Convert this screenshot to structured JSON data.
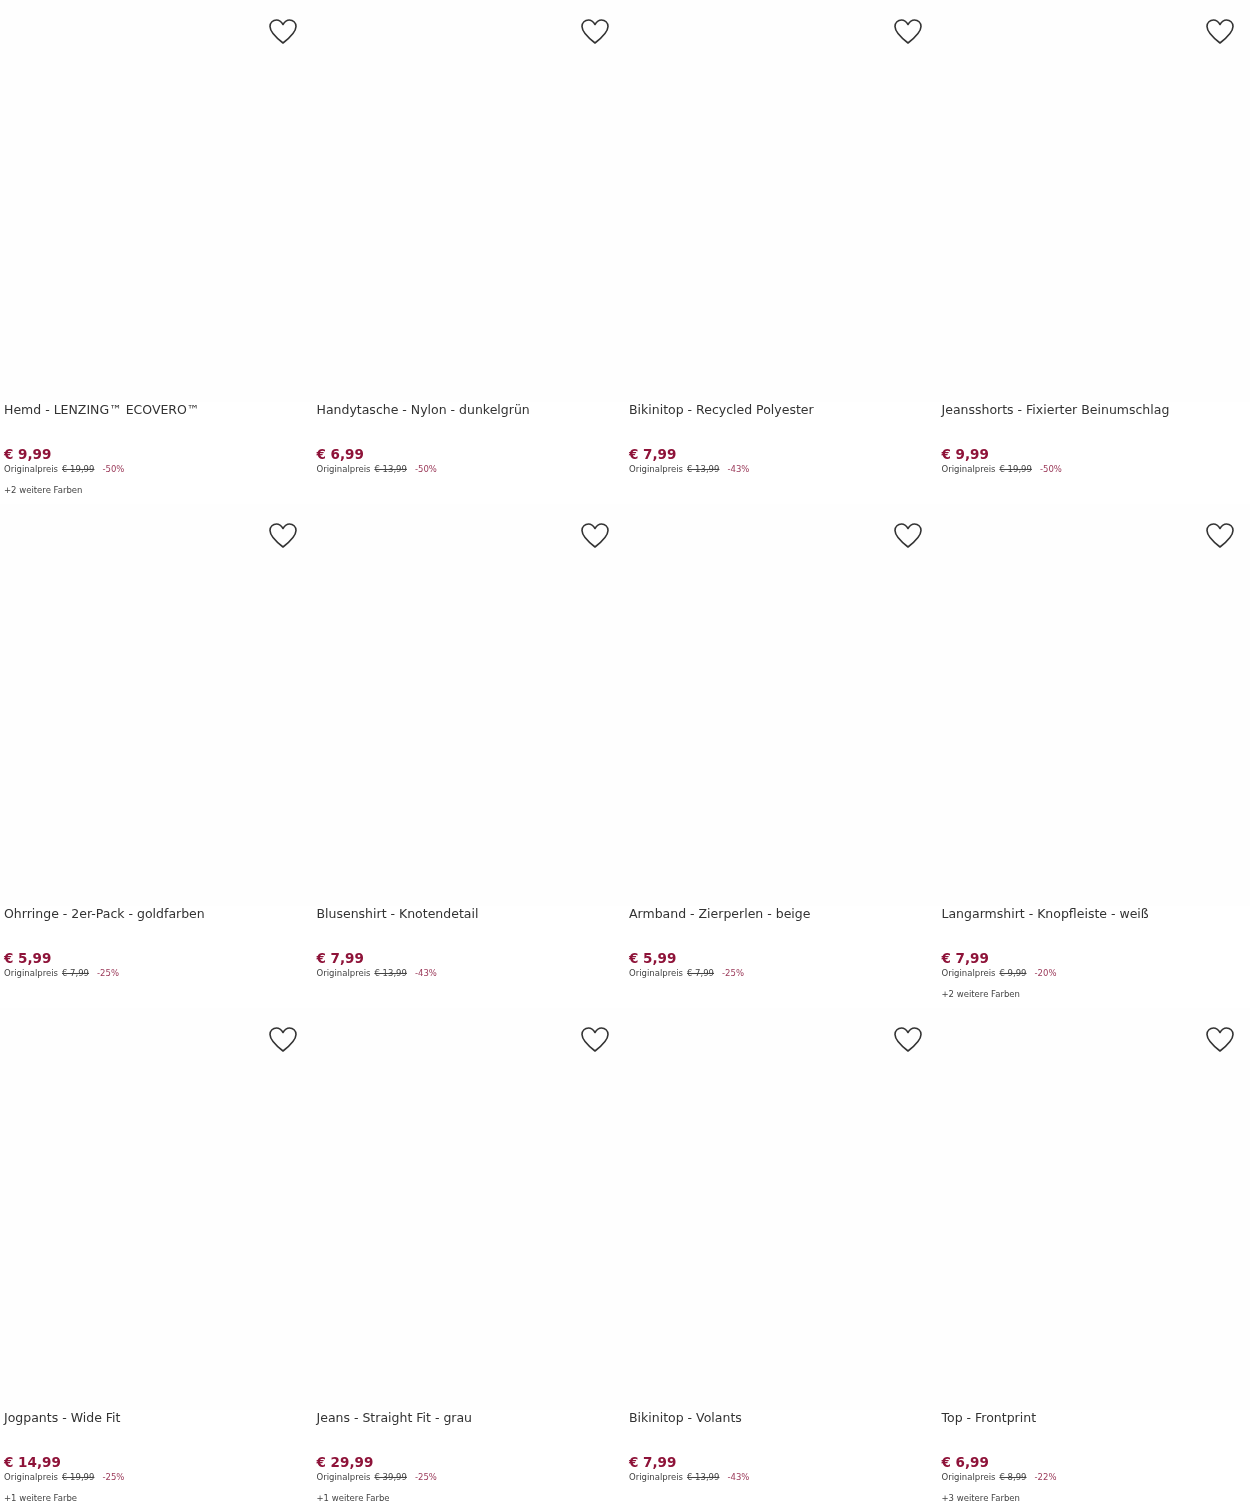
{
  "products": [
    {
      "title": "Hemd - LENZING™ ECOVERO™",
      "price": "€ 9,99",
      "original_label": "Originalpreis",
      "original_price": "€ 19,99",
      "discount": "-50%",
      "more_colors": "+2 weitere Farben"
    },
    {
      "title": "Handytasche - Nylon - dunkelgrün",
      "price": "€ 6,99",
      "original_label": "Originalpreis",
      "original_price": "€ 13,99",
      "discount": "-50%"
    },
    {
      "title": "Bikinitop - Recycled Polyester",
      "price": "€ 7,99",
      "original_label": "Originalpreis",
      "original_price": "€ 13,99",
      "discount": "-43%"
    },
    {
      "title": "Jeansshorts - Fixierter Beinumschlag",
      "price": "€ 9,99",
      "original_label": "Originalpreis",
      "original_price": "€ 19,99",
      "discount": "-50%"
    },
    {
      "title": "Ohrringe - 2er-Pack - goldfarben",
      "price": "€ 5,99",
      "original_label": "Originalpreis",
      "original_price": "€ 7,99",
      "discount": "-25%"
    },
    {
      "title": "Blusenshirt - Knotendetail",
      "price": "€ 7,99",
      "original_label": "Originalpreis",
      "original_price": "€ 13,99",
      "discount": "-43%"
    },
    {
      "title": "Armband - Zierperlen - beige",
      "price": "€ 5,99",
      "original_label": "Originalpreis",
      "original_price": "€ 7,99",
      "discount": "-25%"
    },
    {
      "title": "Langarmshirt - Knopfleiste - weiß",
      "price": "€ 7,99",
      "original_label": "Originalpreis",
      "original_price": "€ 9,99",
      "discount": "-20%",
      "more_colors": "+2 weitere Farben"
    },
    {
      "title": "Jogpants - Wide Fit",
      "price": "€ 14,99",
      "original_label": "Originalpreis",
      "original_price": "€ 19,99",
      "discount": "-25%",
      "more_colors": "+1 weitere Farbe"
    },
    {
      "title": "Jeans - Straight Fit - grau",
      "price": "€ 29,99",
      "original_label": "Originalpreis",
      "original_price": "€ 39,99",
      "discount": "-25%",
      "more_colors": "+1 weitere Farbe"
    },
    {
      "title": "Bikinitop - Volants",
      "price": "€ 7,99",
      "original_label": "Originalpreis",
      "original_price": "€ 13,99",
      "discount": "-43%"
    },
    {
      "title": "Top - Frontprint",
      "price": "€ 6,99",
      "original_label": "Originalpreis",
      "original_price": "€ 8,99",
      "discount": "-22%",
      "more_colors": "+3 weitere Farben"
    }
  ]
}
